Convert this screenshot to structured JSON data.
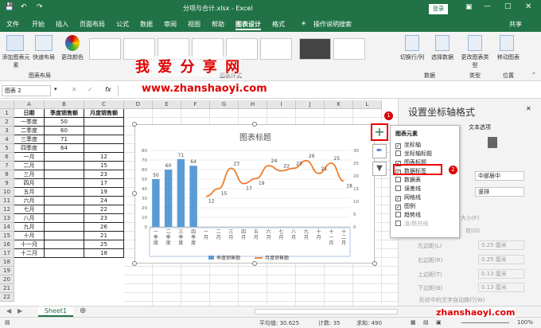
{
  "window": {
    "title": "分项与合计.xlsx - Excel",
    "login": "登录"
  },
  "tabs": [
    "文件",
    "开始",
    "插入",
    "页面布局",
    "公式",
    "数据",
    "审阅",
    "视图",
    "帮助",
    "图表设计",
    "格式",
    "操作说明搜索"
  ],
  "share": "共享",
  "ribbon": {
    "add_element": "添加图表元素",
    "quick_layout": "快速布局",
    "change_color": "更改颜色",
    "group_layout": "图表布局",
    "group_styles": "图表样式",
    "switch": "切换行/列",
    "select_data": "选择数据",
    "group_data": "数据",
    "change_type": "更改图表类型",
    "group_type": "类型",
    "move_chart": "移动图表",
    "group_location": "位置"
  },
  "formula_bar": {
    "name_box": "图表 2",
    "fx": "fx"
  },
  "columns": [
    "A",
    "B",
    "C",
    "D",
    "E",
    "F",
    "G",
    "H",
    "I",
    "J",
    "K",
    "L"
  ],
  "rows": [
    "1",
    "2",
    "3",
    "4",
    "5",
    "6",
    "7",
    "8",
    "9",
    "10",
    "11",
    "12",
    "13",
    "14",
    "15",
    "16",
    "17",
    "18",
    "19",
    "20",
    "21",
    "22"
  ],
  "table": {
    "headers": [
      "日期",
      "季度销售额",
      "月度销售额"
    ],
    "rows": [
      [
        "一季度",
        "50",
        ""
      ],
      [
        "二季度",
        "60",
        ""
      ],
      [
        "三季度",
        "71",
        ""
      ],
      [
        "四季度",
        "64",
        ""
      ],
      [
        "一月",
        "",
        "12"
      ],
      [
        "二月",
        "",
        "15"
      ],
      [
        "三月",
        "",
        "23"
      ],
      [
        "四月",
        "",
        "17"
      ],
      [
        "五月",
        "",
        "19"
      ],
      [
        "六月",
        "",
        "24"
      ],
      [
        "七月",
        "",
        "22"
      ],
      [
        "八月",
        "",
        "23"
      ],
      [
        "九月",
        "",
        "26"
      ],
      [
        "十月",
        "",
        "21"
      ],
      [
        "十一月",
        "",
        "25"
      ],
      [
        "十二月",
        "",
        "18"
      ]
    ]
  },
  "chart_data": {
    "type": "bar",
    "title": "图表标题",
    "categories": [
      "一季度",
      "二季度",
      "三季度",
      "四季度",
      "一月",
      "二月",
      "三月",
      "四月",
      "五月",
      "六月",
      "七月",
      "八月",
      "九月",
      "十月",
      "十一月",
      "十二月"
    ],
    "category_labels": [
      "一\n季\n度",
      "二\n季\n度",
      "三\n季\n度",
      "四\n季\n度",
      "一\n月",
      "二\n月",
      "三\n月",
      "四\n月",
      "五\n月",
      "六\n月",
      "七\n月",
      "八\n月",
      "九\n月",
      "十\n月",
      "十\n一\n月",
      "十\n二\n月"
    ],
    "series": [
      {
        "name": "季度销售额",
        "type": "bar",
        "axis": "left",
        "color": "#5b9bd5",
        "values": [
          50,
          60,
          71,
          64,
          null,
          null,
          null,
          null,
          null,
          null,
          null,
          null,
          null,
          null,
          null,
          null
        ]
      },
      {
        "name": "月度销售额",
        "type": "line",
        "axis": "right",
        "color": "#ed7d31",
        "values": [
          null,
          null,
          null,
          null,
          12,
          15,
          23,
          17,
          19,
          24,
          22,
          23,
          26,
          21,
          25,
          18
        ]
      }
    ],
    "ylim_left": [
      0,
      80
    ],
    "yticks_left": [
      "0",
      "10",
      "20",
      "30",
      "40",
      "50",
      "60",
      "70",
      "80"
    ],
    "ylim_right": [
      0,
      30
    ],
    "yticks_right": [
      "0",
      "5",
      "10",
      "15",
      "20",
      "25",
      "30"
    ],
    "grid": true,
    "legend": "bottom"
  },
  "popup": {
    "title": "图表元素",
    "items": [
      {
        "label": "坐标轴",
        "checked": true
      },
      {
        "label": "坐标轴标题",
        "checked": false
      },
      {
        "label": "图表标题",
        "checked": true
      },
      {
        "label": "数据标签",
        "checked": true
      },
      {
        "label": "数据表",
        "checked": false
      },
      {
        "label": "误差线",
        "checked": false
      },
      {
        "label": "网格线",
        "checked": true
      },
      {
        "label": "图例",
        "checked": true
      },
      {
        "label": "趋势线",
        "checked": false
      },
      {
        "label": "涨/跌柱线",
        "checked": false
      }
    ]
  },
  "pane": {
    "title": "设置坐标轴格式",
    "text_options": "文本选项",
    "vertical_align": "中部居中",
    "text_direction": "竖排",
    "autofit": "形状大小(F)",
    "overflow": "状(O)",
    "left_margin": "左边距(L)",
    "left_val": "0.25 厘米",
    "right_margin": "右边距(R)",
    "right_val": "0.25 厘米",
    "top_margin": "上边距(T)",
    "top_val": "0.13 厘米",
    "bottom_margin": "下边距(B)",
    "bottom_val": "0.13 厘米",
    "wrap": "形状中的文字自动换行(W)"
  },
  "sheet": "Sheet1",
  "status": {
    "avg": "平均值: 30.625",
    "count": "计数: 35",
    "sum": "求和: 490",
    "zoom": "100%"
  },
  "watermark": {
    "cn": "我 爱 分 享 网",
    "url": "www.zhanshaoyi.com",
    "url2": "zhanshaoyi.com"
  },
  "badges": [
    "1",
    "2"
  ]
}
